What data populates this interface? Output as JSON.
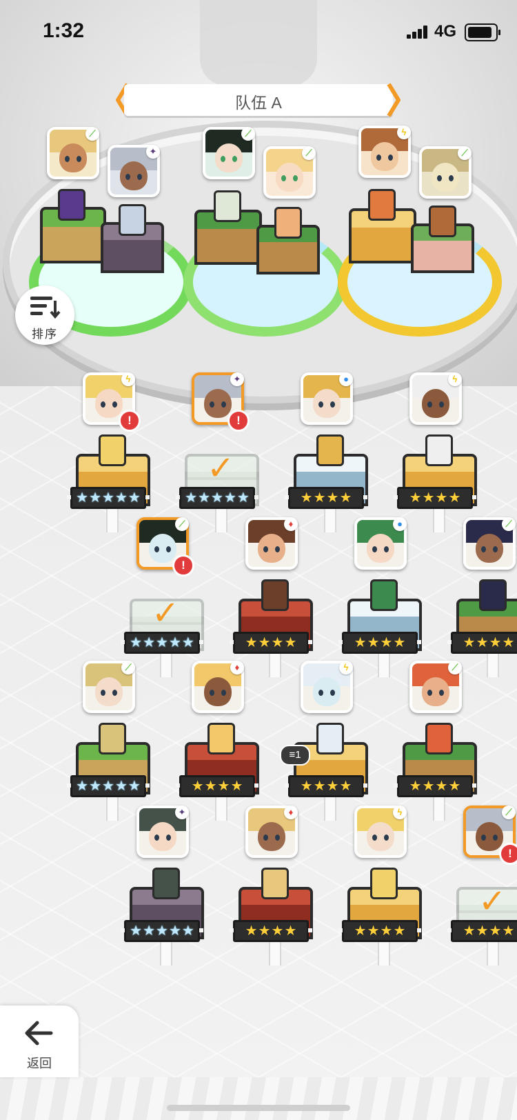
{
  "status_bar": {
    "time": "1:32",
    "network": "4G"
  },
  "team": {
    "title": "队伍 A"
  },
  "sort": {
    "label": "排序"
  },
  "back": {
    "label": "返回"
  },
  "squad_badge": {
    "count": "1"
  },
  "elements": {
    "nature": "⟋",
    "light": "ϟ",
    "dark": "✦",
    "water": "●",
    "fire": "♦"
  },
  "colors": {
    "selected_border": "#f29a25",
    "alert": "#e23b3b",
    "star_gold": "#ffcf3a",
    "nature": "#6bc04b",
    "light": "#f1c40f",
    "dark": "#5a3c7a",
    "water": "#2f8fe8",
    "fire": "#e0413a"
  },
  "roster_rows": [
    [
      {
        "stars": "★★★★★",
        "star_type": "rainbow",
        "element": "light",
        "alert": "!",
        "selected": false,
        "in_team": false
      },
      {
        "stars": "★★★★★",
        "star_type": "rainbow",
        "element": "dark",
        "alert": "!",
        "selected": true,
        "in_team": true
      },
      {
        "stars": "★★★★",
        "star_type": "gold",
        "element": "water",
        "alert": "",
        "selected": false,
        "in_team": false
      },
      {
        "stars": "★★★★",
        "star_type": "gold",
        "element": "light",
        "alert": "",
        "selected": false,
        "in_team": false
      }
    ],
    [
      {
        "stars": "★★★★★",
        "star_type": "rainbow",
        "element": "nature",
        "alert": "!",
        "selected": true,
        "in_team": true
      },
      {
        "stars": "★★★★",
        "star_type": "gold",
        "element": "fire",
        "alert": "",
        "selected": false,
        "in_team": false
      },
      {
        "stars": "★★★★",
        "star_type": "gold",
        "element": "water",
        "alert": "",
        "selected": false,
        "in_team": false
      },
      {
        "stars": "★★★★",
        "star_type": "gold",
        "element": "nature",
        "alert": "",
        "selected": false,
        "in_team": false
      }
    ],
    [
      {
        "stars": "★★★★★",
        "star_type": "rainbow",
        "element": "nature",
        "alert": "",
        "selected": false,
        "in_team": false
      },
      {
        "stars": "★★★★",
        "star_type": "gold",
        "element": "fire",
        "alert": "",
        "selected": false,
        "in_team": false
      },
      {
        "stars": "★★★★",
        "star_type": "gold",
        "element": "light",
        "alert": "",
        "selected": false,
        "in_team": false
      },
      {
        "stars": "★★★★",
        "star_type": "gold",
        "element": "nature",
        "alert": "",
        "selected": false,
        "in_team": false
      }
    ],
    [
      {
        "stars": "★★★★★",
        "star_type": "rainbow",
        "element": "dark",
        "alert": "",
        "selected": false,
        "in_team": false
      },
      {
        "stars": "★★★★",
        "star_type": "gold",
        "element": "fire",
        "alert": "",
        "selected": false,
        "in_team": false
      },
      {
        "stars": "★★★★",
        "star_type": "gold",
        "element": "light",
        "alert": "",
        "selected": false,
        "in_team": false
      },
      {
        "stars": "★★★★",
        "star_type": "gold",
        "element": "nature",
        "alert": "!",
        "selected": true,
        "in_team": true
      }
    ]
  ],
  "team_slots": [
    {
      "element_front": "nature",
      "element_back": "dark"
    },
    {
      "element_front": "nature",
      "element_back": "nature"
    },
    {
      "element_front": "light",
      "element_back": "nature"
    }
  ]
}
